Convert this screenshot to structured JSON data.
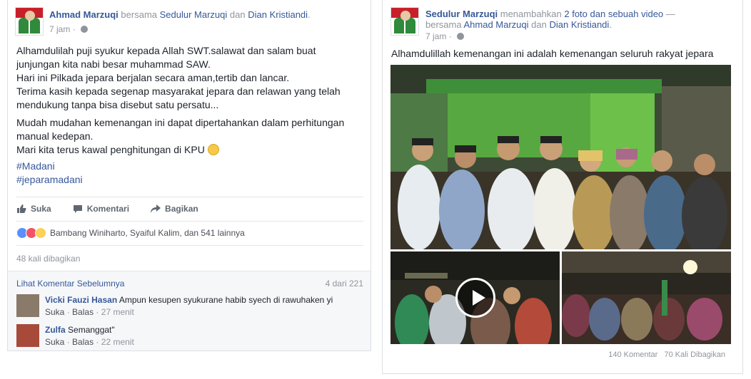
{
  "left_post": {
    "author": "Ahmad Marzuqi",
    "with_word": "bersama",
    "tagged_1": "Sedulur Marzuqi",
    "and_word": "dan",
    "tagged_2": "Dian Kristiandi",
    "period": ".",
    "time": "7 jam",
    "dot": "·",
    "privacy_icon": "globe-icon",
    "paragraph_1": "Alhamdulilah puji syukur kepada Allah SWT.salawat dan salam buat junjungan kita nabi besar muhammad SAW. Hari ini Pilkada jepara berjalan secara aman,tertib dan lancar. Terima kasih kepada segenap masyarakat jepara dan relawan yang telah mendukung tanpa bisa disebut satu persatu...",
    "line_1": "Alhamdulilah puji syukur kepada Allah SWT.salawat dan salam buat",
    "line_2": "junjungan kita nabi besar muhammad SAW.",
    "line_3": "Hari ini Pilkada jepara berjalan secara aman,tertib dan lancar.",
    "line_4": "Terima kasih kepada segenap masyarakat jepara dan relawan yang telah",
    "line_5": "mendukung tanpa bisa disebut satu persatu...",
    "line_6": "Mudah mudahan kemenangan ini dapat dipertahankan dalam perhitungan",
    "line_7": "manual kedepan.",
    "line_8": "Mari kita terus kawal penghitungan di KPU",
    "hashtag_1": "#Madani",
    "hashtag_2": "#jeparamadani",
    "actions": {
      "like": "Suka",
      "comment": "Komentari",
      "share": "Bagikan"
    },
    "reactions_text": "Bambang Winiharto, Syaiful Kalim, dan 541 lainnya",
    "share_count": "48 kali dibagikan",
    "prev_comments_label": "Lihat Komentar Sebelumnya",
    "prev_comments_count": "4 dari 221",
    "comments": [
      {
        "name": "Vicki Fauzi Hasan",
        "text": "Ampun kesupen syukurane habib syech di rawuhaken yi",
        "like": "Suka",
        "reply": "Balas",
        "time": "27 menit",
        "sep": "·"
      },
      {
        "name": "Zulfa",
        "text": "Semanggat\"",
        "like": "Suka",
        "reply": "Balas",
        "time": "22 menit",
        "sep": "·"
      }
    ]
  },
  "right_post": {
    "author": "Sedulur Marzuqi",
    "action_text": "menambahkan",
    "media_text": "2 foto dan sebuah video",
    "dash": "—",
    "with_word": "bersama",
    "tagged_1": "Ahmad Marzuqi",
    "and_word": "dan",
    "tagged_2": "Dian Kristiandi",
    "period": ".",
    "time": "7 jam",
    "dot": "·",
    "caption": "Alhamdulillah kemenangan ini adalah kemenangan seluruh rakyat jepara",
    "comment_count": "140 Komentar",
    "share_count": "70 Kali Dibagikan"
  },
  "colors": {
    "link": "#365899",
    "muted": "#90949c",
    "like_blue": "#5890ff",
    "love_red": "#f25268",
    "wow_yellow": "#fcd05b"
  }
}
